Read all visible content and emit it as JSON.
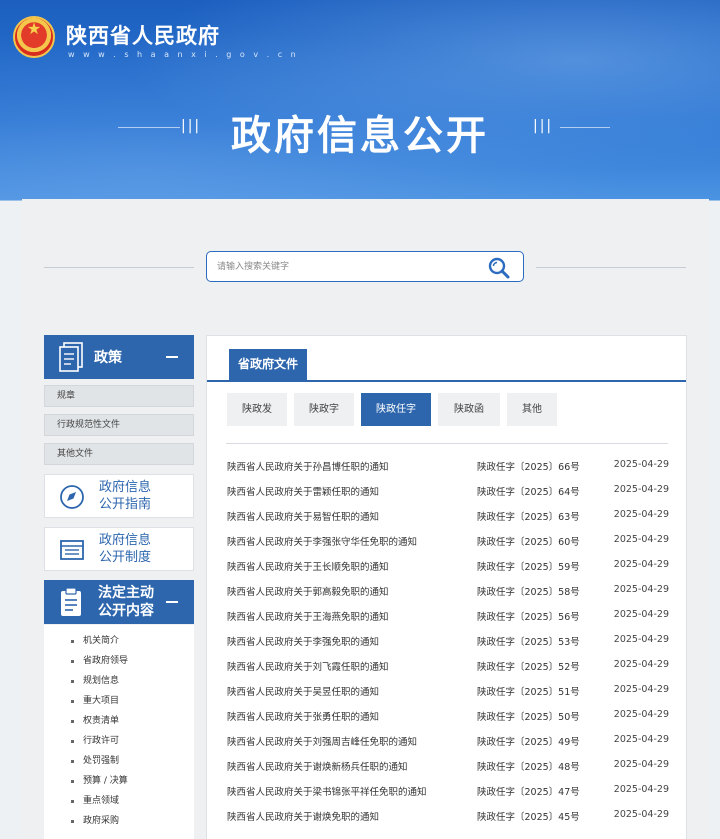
{
  "header": {
    "site_title": "陕西省人民政府",
    "site_url": "w w w . s h a a n x i . g o v . c n",
    "page_heading": "政府信息公开"
  },
  "search": {
    "placeholder": "请输入搜索关键字",
    "icon": "search-icon"
  },
  "sidebar": {
    "policy": {
      "label": "政策",
      "icon": "document-icon",
      "items": [
        "规章",
        "行政规范性文件",
        "其他文件"
      ]
    },
    "guide": {
      "label_line1": "政府信息",
      "label_line2": "公开指南",
      "icon": "compass-icon"
    },
    "system": {
      "label_line1": "政府信息",
      "label_line2": "公开制度",
      "icon": "list-icon"
    },
    "statutory": {
      "label_line1": "法定主动",
      "label_line2": "公开内容",
      "icon": "clipboard-icon",
      "items": [
        "机关简介",
        "省政府领导",
        "规划信息",
        "重大项目",
        "权责清单",
        "行政许可",
        "处罚强制",
        "预算 / 决算",
        "重点领域",
        "政府采购"
      ]
    }
  },
  "main": {
    "title": "省政府文件",
    "tabs": [
      {
        "label": "陕政发",
        "active": false
      },
      {
        "label": "陕政字",
        "active": false
      },
      {
        "label": "陕政任字",
        "active": true
      },
      {
        "label": "陕政函",
        "active": false
      },
      {
        "label": "其他",
        "active": false
      }
    ],
    "rows": [
      {
        "title": "陕西省人民政府关于孙昌博任职的通知",
        "number": "陕政任字〔2025〕66号",
        "date": "2025-04-29"
      },
      {
        "title": "陕西省人民政府关于雷颖任职的通知",
        "number": "陕政任字〔2025〕64号",
        "date": "2025-04-29"
      },
      {
        "title": "陕西省人民政府关于易智任职的通知",
        "number": "陕政任字〔2025〕63号",
        "date": "2025-04-29"
      },
      {
        "title": "陕西省人民政府关于李强张守华任免职的通知",
        "number": "陕政任字〔2025〕60号",
        "date": "2025-04-29"
      },
      {
        "title": "陕西省人民政府关于王长顺免职的通知",
        "number": "陕政任字〔2025〕59号",
        "date": "2025-04-29"
      },
      {
        "title": "陕西省人民政府关于郭高毅免职的通知",
        "number": "陕政任字〔2025〕58号",
        "date": "2025-04-29"
      },
      {
        "title": "陕西省人民政府关于王海燕免职的通知",
        "number": "陕政任字〔2025〕56号",
        "date": "2025-04-29"
      },
      {
        "title": "陕西省人民政府关于李强免职的通知",
        "number": "陕政任字〔2025〕53号",
        "date": "2025-04-29"
      },
      {
        "title": "陕西省人民政府关于刘飞霞任职的通知",
        "number": "陕政任字〔2025〕52号",
        "date": "2025-04-29"
      },
      {
        "title": "陕西省人民政府关于吴昱任职的通知",
        "number": "陕政任字〔2025〕51号",
        "date": "2025-04-29"
      },
      {
        "title": "陕西省人民政府关于张勇任职的通知",
        "number": "陕政任字〔2025〕50号",
        "date": "2025-04-29"
      },
      {
        "title": "陕西省人民政府关于刘强周吉峰任免职的通知",
        "number": "陕政任字〔2025〕49号",
        "date": "2025-04-29"
      },
      {
        "title": "陕西省人民政府关于谢焕新杨兵任职的通知",
        "number": "陕政任字〔2025〕48号",
        "date": "2025-04-29"
      },
      {
        "title": "陕西省人民政府关于梁书锦张平祥任免职的通知",
        "number": "陕政任字〔2025〕47号",
        "date": "2025-04-29"
      },
      {
        "title": "陕西省人民政府关于谢焕免职的通知",
        "number": "陕政任字〔2025〕45号",
        "date": "2025-04-29"
      }
    ]
  }
}
